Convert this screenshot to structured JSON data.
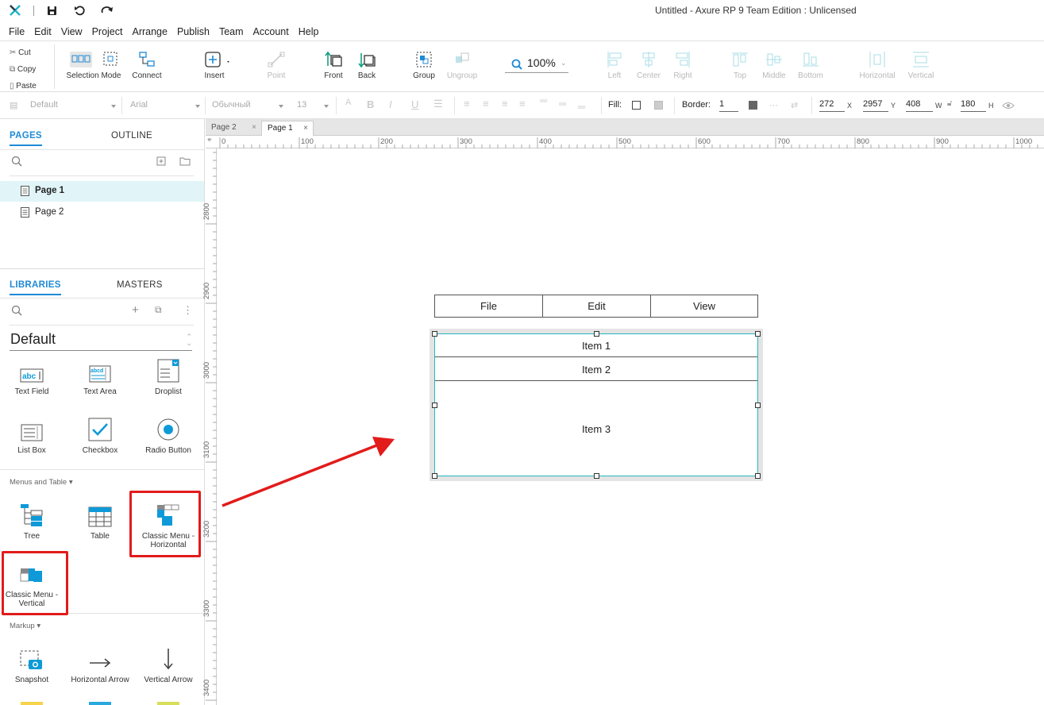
{
  "app": {
    "title": "Untitled - Axure RP 9 Team Edition : Unlicensed"
  },
  "menu": [
    "File",
    "Edit",
    "View",
    "Project",
    "Arrange",
    "Publish",
    "Team",
    "Account",
    "Help"
  ],
  "clipboard": {
    "cut": "Cut",
    "copy": "Copy",
    "paste": "Paste"
  },
  "toolbar": {
    "selection_mode": "Selection Mode",
    "connect": "Connect",
    "insert": "Insert",
    "point": "Point",
    "zoom": "100%",
    "front": "Front",
    "back": "Back",
    "group": "Group",
    "ungroup": "Ungroup",
    "left": "Left",
    "center": "Center",
    "right": "Right",
    "top": "Top",
    "middle": "Middle",
    "bottom": "Bottom",
    "horizontal": "Horizontal",
    "vertical": "Vertical"
  },
  "format": {
    "style": "Default",
    "font": "Arial",
    "weight": "Обычный",
    "size": "13",
    "fill_label": "Fill:",
    "border_label": "Border:",
    "border_value": "1",
    "x": "272",
    "x_label": "X",
    "y": "2957",
    "y_label": "Y",
    "w": "408",
    "w_label": "W",
    "h": "180",
    "h_label": "H"
  },
  "pages_panel": {
    "tab_pages": "PAGES",
    "tab_outline": "OUTLINE",
    "pages": [
      "Page 1",
      "Page 2"
    ]
  },
  "libraries_panel": {
    "tab_libraries": "LIBRARIES",
    "tab_masters": "MASTERS",
    "library_name": "Default",
    "items_forms": [
      "Text Field",
      "Text Area",
      "Droplist",
      "List Box",
      "Checkbox",
      "Radio Button"
    ],
    "section_menus": "Menus and Table ▾",
    "items_menus": [
      "Tree",
      "Table",
      "Classic Menu - Horizontal",
      "Classic Menu - Vertical"
    ],
    "section_markup": "Markup ▾",
    "items_markup": [
      "Snapshot",
      "Horizontal Arrow",
      "Vertical Arrow"
    ]
  },
  "canvas_tabs": [
    "Page 2",
    "Page 1"
  ],
  "ruler": {
    "h_ticks": [
      "0",
      "100",
      "200",
      "300",
      "400",
      "500",
      "600",
      "700",
      "800",
      "900",
      "1000"
    ],
    "v_ticks": [
      "2800",
      "2900",
      "3000",
      "3100",
      "3200",
      "3300",
      "3400"
    ]
  },
  "widgets": {
    "horizontal_menu": [
      "File",
      "Edit",
      "View"
    ],
    "vertical_menu": [
      "Item 1",
      "Item 2",
      "Item 3"
    ]
  },
  "colors": {
    "accent": "#1e8ad6",
    "highlight": "#e21b1b",
    "selection": "#26b8c0",
    "icon_blue": "#0e9ad8"
  }
}
